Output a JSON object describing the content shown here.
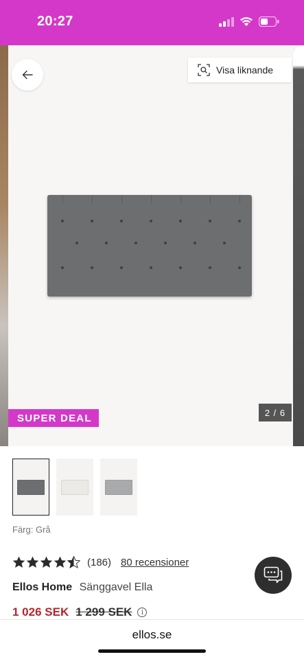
{
  "status_bar": {
    "time": "20:27",
    "color": "#d438c9"
  },
  "toolbar": {
    "back_icon": "arrow-left-icon",
    "similar_icon": "visual-search-icon",
    "similar_label": "Visa liknande"
  },
  "gallery": {
    "badge": "SUPER DEAL",
    "badge_color": "#d438c9",
    "counter": "2 / 6",
    "thumbnails": [
      {
        "color": "#6d6e70",
        "selected": true
      },
      {
        "color": "#eceae6",
        "selected": false
      },
      {
        "color": "#a9aaac",
        "selected": false
      }
    ]
  },
  "product": {
    "color_label": "Färg: Grå",
    "rating": 4.5,
    "rating_count": "(186)",
    "reviews_link": "80 recensioner",
    "brand": "Ellos Home",
    "name": "Sänggavel Ella",
    "price_now": "1 026 SEK",
    "price_old": "1 299 SEK",
    "price_color": "#b4262b",
    "info_icon": "info-icon"
  },
  "chat": {
    "icon": "chat-bubble-icon"
  },
  "browser": {
    "url": "ellos.se"
  }
}
